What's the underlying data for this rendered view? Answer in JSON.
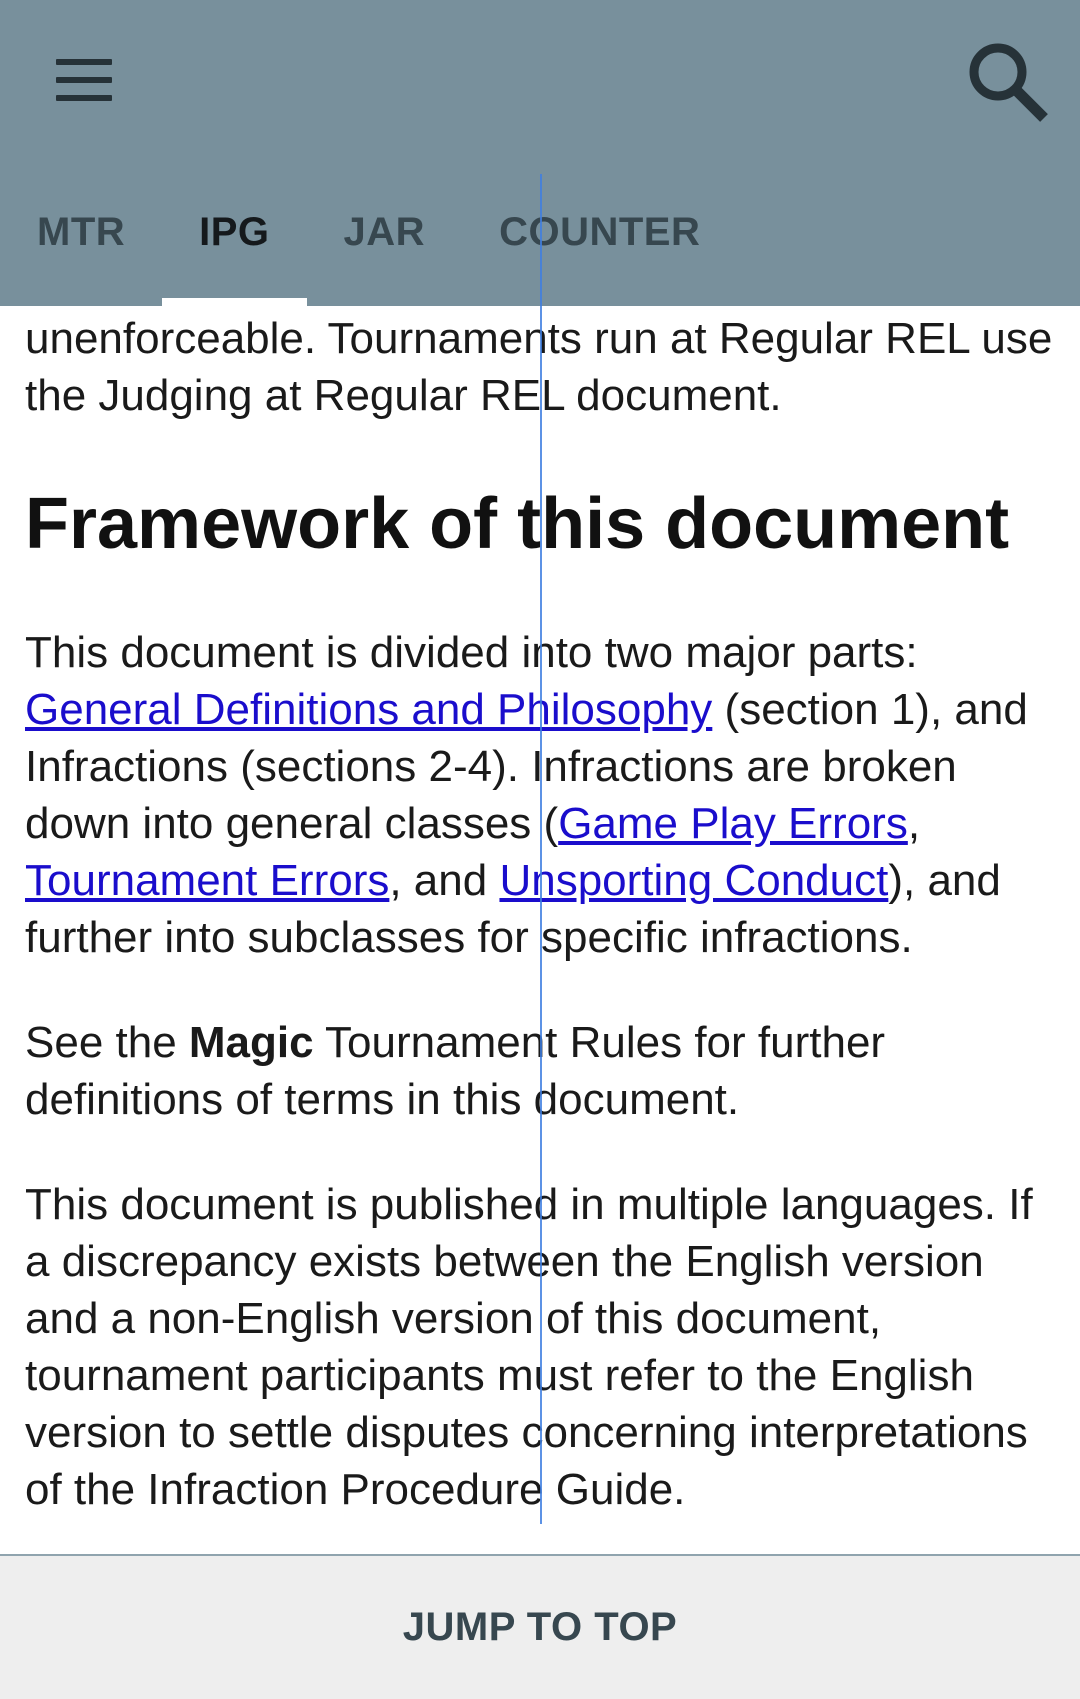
{
  "header": {
    "menu_icon": "hamburger-menu-icon",
    "search_icon": "search-icon",
    "tabs": [
      {
        "label": "MTR",
        "active": false
      },
      {
        "label": "IPG",
        "active": true
      },
      {
        "label": "JAR",
        "active": false
      },
      {
        "label": "COUNTER",
        "active": false
      }
    ]
  },
  "content": {
    "p_top": "unenforceable. Tournaments run at Regular REL use the Judging at Regular REL document.",
    "heading": "Framework of this document",
    "p1": {
      "t1": "This document is divided into two major parts: ",
      "link1": "General Definitions and Philosophy",
      "t2": " (section 1), and Infractions (sections 2-4). Infractions are broken down into general classes (",
      "link2": "Game Play Errors",
      "t3": ", ",
      "link3": "Tournament Errors",
      "t4": ", and ",
      "link4": "Unsporting Conduct",
      "t5": "), and further into subclasses for specific infractions."
    },
    "p2": {
      "t1": "See the ",
      "bold": "Magic",
      "t2": " Tournament Rules for further definitions of terms in this document."
    },
    "p3": "This document is published in multiple languages. If a discrepancy exists between the English version and a non-English version of this document, tournament participants must refer to the English version to settle disputes concerning interpretations of the Infraction Procedure Guide."
  },
  "footer": {
    "jump_label": "JUMP TO TOP"
  },
  "colors": {
    "appbar": "#78909c",
    "link": "#1a0dcc",
    "tab_text": "#37474f",
    "footer_bg": "#eeeeee"
  }
}
